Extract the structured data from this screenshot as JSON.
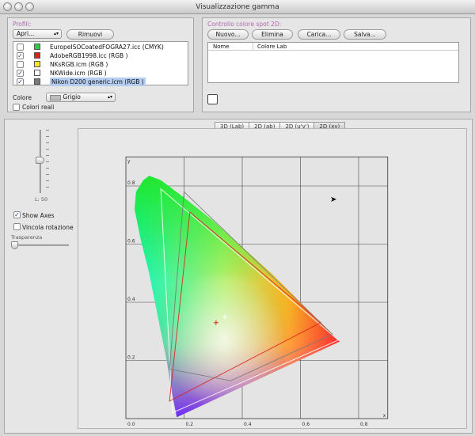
{
  "window": {
    "title": "Visualizzazione gamma"
  },
  "profiles": {
    "group_label": "Profili:",
    "open_select": "Apri...",
    "remove_label": "Rimuovi",
    "items": [
      {
        "checked": false,
        "color": "#2ecc40",
        "label": "EuropeISOCoatedFOGRA27.icc (CMYK)",
        "selected": false
      },
      {
        "checked": true,
        "color": "#e0201a",
        "label": "AdobeRGB1998.icc (RGB )",
        "selected": false
      },
      {
        "checked": false,
        "color": "#f2e81a",
        "label": "NKsRGB.icm (RGB )",
        "selected": false
      },
      {
        "checked": true,
        "color": "#ffffff",
        "label": "NKWide.icm (RGB )",
        "selected": false
      },
      {
        "checked": true,
        "color": "#7a7a7a",
        "label": "Nikon D200 generic.icm (RGB )",
        "selected": true
      }
    ],
    "color_label": "Colore",
    "color_select": "Grigio",
    "real_colors_label": "Colori reali"
  },
  "spot": {
    "group_label": "Controllo colore spot 2D:",
    "buttons": {
      "new": "Nuovo...",
      "delete": "Elimina",
      "load": "Carica...",
      "save": "Salva..."
    },
    "columns": [
      "Nome",
      "Colore Lab"
    ]
  },
  "side": {
    "slider_label": "L: 50",
    "show_axes": {
      "label": "Show Axes",
      "checked": true
    },
    "lock_rotation": {
      "label": "Vincola rotazione",
      "checked": false
    },
    "transparency_label": "Trasparenza"
  },
  "views": {
    "tabs": [
      "3D (Lab)",
      "2D (ab)",
      "2D (u'v')",
      "2D (xy)"
    ],
    "active": 3
  },
  "chart_data": {
    "type": "scatter",
    "title": "",
    "xlabel": "x",
    "ylabel": "y",
    "xlim": [
      0,
      0.9
    ],
    "ylim": [
      0,
      0.9
    ],
    "x_ticks": [
      "0.0",
      "0.2",
      "0.4",
      "0.6",
      "0.8"
    ],
    "y_ticks": [
      "0.0",
      "0.2",
      "0.4",
      "0.6",
      "0.8"
    ],
    "grid": true,
    "series": [
      {
        "color": "#ffffff",
        "points": [
          [
            0.12,
            0.79
          ],
          [
            0.73,
            0.27
          ],
          [
            0.16,
            0.02
          ]
        ]
      },
      {
        "color": "#e0201a",
        "points": [
          [
            0.22,
            0.71
          ],
          [
            0.67,
            0.33
          ],
          [
            0.15,
            0.06
          ]
        ]
      },
      {
        "color": "#7a7a7a",
        "points": [
          [
            0.2,
            0.78
          ],
          [
            0.71,
            0.29
          ],
          [
            0.36,
            0.13
          ],
          [
            0.15,
            0.17
          ]
        ]
      }
    ],
    "white_point": [
      0.31,
      0.33
    ],
    "cursor_marker": [
      0.34,
      0.35
    ]
  }
}
